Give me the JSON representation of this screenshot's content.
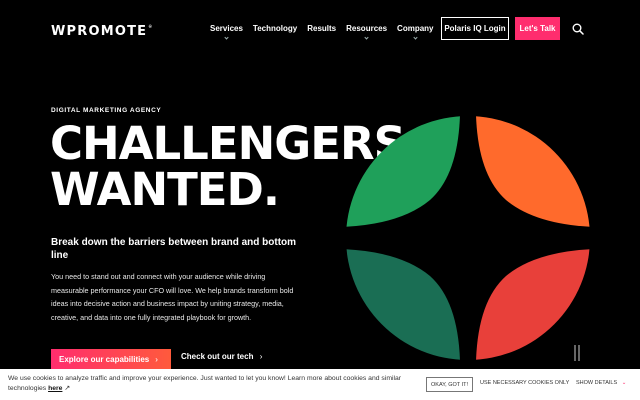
{
  "header": {
    "logo": "WPROMOTE",
    "logo_mark": "®",
    "nav": [
      {
        "label": "Services",
        "dropdown": true
      },
      {
        "label": "Technology",
        "dropdown": false
      },
      {
        "label": "Results",
        "dropdown": false
      },
      {
        "label": "Resources",
        "dropdown": true
      },
      {
        "label": "Company",
        "dropdown": true
      }
    ],
    "login_label": "Polaris IQ Login",
    "talk_label": "Let's Talk",
    "search_icon": "search-icon"
  },
  "hero": {
    "eyebrow": "DIGITAL MARKETING AGENCY",
    "headline_line1": "CHALLENGERS",
    "headline_line2": "WANTED.",
    "subhead": "Break down the barriers between brand and bottom line",
    "body": "You need to stand out and connect with your audience while driving measurable performance your CFO will love. We help brands transform bold ideas into decisive action and business impact by uniting strategy, media, creative, and data into one fully integrated playbook for growth.",
    "cta_primary": "Explore our capabilities",
    "cta_secondary": "Check out our tech",
    "art_colors": {
      "green": "#1fa05a",
      "orange": "#ff6a2c",
      "teal": "#1a6e54",
      "red": "#e8403a"
    }
  },
  "cookie_banner": {
    "text": "We use cookies to analyze traffic and improve your experience. Just wanted to let you know! Learn more about cookies and similar technologies",
    "link_label": "here",
    "ok_label": "OKAY, GOT IT!",
    "necessary_label": "USE NECESSARY COOKIES ONLY",
    "details_label": "SHOW DETAILS"
  },
  "colors": {
    "accent": "#ff2d6e",
    "background": "#000000"
  }
}
